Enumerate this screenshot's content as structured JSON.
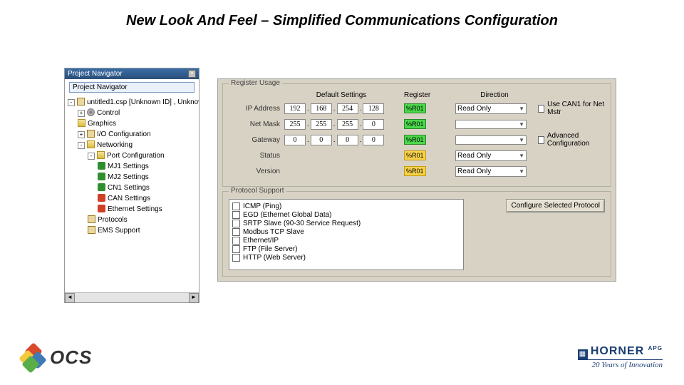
{
  "title": "New Look And Feel – Simplified Communications Configuration",
  "nav": {
    "panel_title": "Project Navigator",
    "subtitle": "Project Navigator",
    "root": "untitled1.csp [Unknown ID] , Unknow",
    "control": "Control",
    "graphics": "Graphics",
    "ioconfig": "I/O Configuration",
    "networking": "Networking",
    "portcfg": "Port Configuration",
    "mj1": "MJ1 Settings",
    "mj2": "MJ2 Settings",
    "cn1": "CN1 Settings",
    "can": "CAN Settings",
    "eth": "Ethernet Settings",
    "protocols": "Protocols",
    "emssupport": "EMS Support"
  },
  "cfg": {
    "group_reg": "Register Usage",
    "hdr_default": "Default Settings",
    "hdr_register": "Register",
    "hdr_direction": "Direction",
    "labels": {
      "ip": "IP Address",
      "mask": "Net Mask",
      "gw": "Gateway",
      "status": "Status",
      "version": "Version"
    },
    "ip": [
      "192",
      "168",
      "254",
      "128"
    ],
    "mask": [
      "255",
      "255",
      "255",
      "0"
    ],
    "gw": [
      "0",
      "0",
      "0",
      "0"
    ],
    "reg": {
      "ip": "%R01",
      "mask": "%R01",
      "gw": "%R01",
      "status": "%R01",
      "version": "%R01"
    },
    "dir": {
      "ip": "Read Only",
      "mask": "",
      "gw": "",
      "status": "Read Only",
      "version": "Read Only"
    },
    "cb_usecan": "Use CAN1 for Net Mstr",
    "cb_advcfg": "Advanced Configuration",
    "group_proto": "Protocol Support",
    "protocols": [
      "ICMP (Ping)",
      "EGD (Ethernet Global Data)",
      "SRTP Slave (90-30 Service Request)",
      "Modbus TCP Slave",
      "Ethernet/IP",
      "FTP (File Server)",
      "HTTP (Web Server)"
    ],
    "btn_cfg_proto": "Configure Selected Protocol"
  },
  "footer": {
    "ocs": "OCS",
    "horner": "HORNER",
    "horner_sub": "20 Years of Innovation",
    "apg": "APG"
  }
}
